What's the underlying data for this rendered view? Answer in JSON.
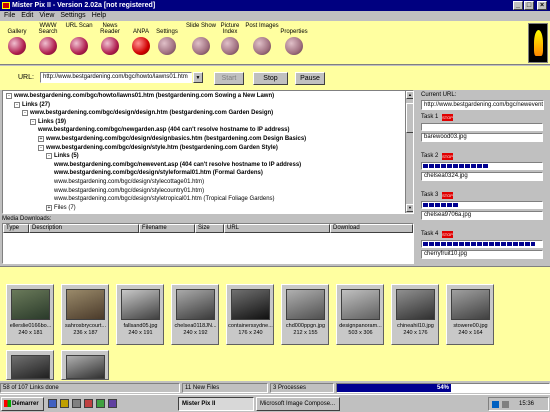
{
  "window": {
    "title": "Mister Pix II - Version 2.02a [not registered]"
  },
  "menu": [
    "File",
    "Edit",
    "View",
    "Settings",
    "Help"
  ],
  "toolbar": {
    "tools": [
      {
        "label": "Gallery",
        "icon": "gallery-icon"
      },
      {
        "label": "WWW Search",
        "icon": "search-icon"
      },
      {
        "label": "URL Scan",
        "icon": "url-scan-icon"
      },
      {
        "label": "News Reader",
        "icon": "news-reader-icon"
      },
      {
        "label": "ANPA",
        "icon": "anpa-icon"
      },
      {
        "label": "Settings",
        "icon": "settings-icon"
      },
      {
        "label": "Slide Show",
        "icon": "slide-show-icon"
      },
      {
        "label": "Picture Index",
        "icon": "picture-index-icon"
      },
      {
        "label": "Post Images",
        "icon": "post-images-icon"
      },
      {
        "label": "Properties",
        "icon": "properties-icon"
      }
    ]
  },
  "urlbar": {
    "label": "URL:",
    "value": "http://www.bestgardening.com/bgc/howto/lawns01.htm",
    "start": "Start",
    "stop": "Stop",
    "pause": "Pause"
  },
  "tree": [
    {
      "text": "www.bestgardening.com/bgc/howto/lawns01.htm (bestgardening.com Sowing a New Lawn)",
      "pm": "-",
      "indent": 0,
      "bold": true
    },
    {
      "text": "Links (27)",
      "pm": "-",
      "indent": 1,
      "bold": true
    },
    {
      "text": "www.bestgardening.com/bgc/design/design.htm (bestgardening.com Garden Design)",
      "pm": "-",
      "indent": 2,
      "bold": true
    },
    {
      "text": "Links (19)",
      "pm": "-",
      "indent": 3,
      "bold": true
    },
    {
      "text": "www.bestgardening.com/bgc/newgarden.asp (404 can't resolve hostname to IP address)",
      "pm": "",
      "indent": 4,
      "bold": true
    },
    {
      "text": "www.bestgardening.com/bgc/design/designbasics.htm (bestgardening.com Design Basics)",
      "pm": "+",
      "indent": 4,
      "bold": true
    },
    {
      "text": "www.bestgardening.com/bgc/design/style.htm (bestgardening.com Garden Style)",
      "pm": "-",
      "indent": 4,
      "bold": true
    },
    {
      "text": "Links (5)",
      "pm": "-",
      "indent": 5,
      "bold": true
    },
    {
      "text": "www.bestgardening.com/bgc/newevent.asp (404 can't resolve hostname to IP address)",
      "pm": "",
      "indent": 6,
      "bold": true
    },
    {
      "text": "www.bestgardening.com/bgc/design/styleformal01.htm (Formal Gardens)",
      "pm": "",
      "indent": 6,
      "bold": true
    },
    {
      "text": "www.bestgardening.com/bgc/design/stylecottage01.htm)",
      "pm": "",
      "indent": 6,
      "bold": false
    },
    {
      "text": "www.bestgardening.com/bgc/design/stylecountry01.htm)",
      "pm": "",
      "indent": 6,
      "bold": false
    },
    {
      "text": "www.bestgardening.com/bgc/design/styletropical01.htm (Tropical Foliage Gardens)",
      "pm": "",
      "indent": 6,
      "bold": false
    },
    {
      "text": "Files (7)",
      "pm": "+",
      "indent": 5,
      "bold": false
    }
  ],
  "media": {
    "label": "Media Downloads:",
    "columns": [
      "Type",
      "Description",
      "Filename",
      "Size",
      "URL",
      "Download"
    ]
  },
  "current": {
    "label": "Current URL:",
    "url": "http://www.bestgardening.com/bgc/newevent.asp"
  },
  "tasks": [
    {
      "label": "Task 1",
      "stop": "STOP",
      "file": "barewood03.jpg",
      "progress": 0
    },
    {
      "label": "Task 2",
      "stop": "STOP",
      "file": "chelsea0324.jpg",
      "progress": 0.55
    },
    {
      "label": "Task 3",
      "stop": "STOP",
      "file": "chelsea9706a.jpg",
      "progress": 0.3
    },
    {
      "label": "Task 4",
      "stop": "STOP",
      "file": "cherryfruit10.jpg",
      "progress": 0.95
    }
  ],
  "gallery": [
    {
      "name": "ellerslie0166bo...",
      "dims": "240 x 181",
      "colors": [
        "#6a7a5a",
        "#2a3a2a"
      ]
    },
    {
      "name": "sahrosbrycourt...",
      "dims": "236 x 187",
      "colors": [
        "#9a8a6a",
        "#4a3a2a"
      ]
    },
    {
      "name": "fallsand05.jpg",
      "dims": "240 x 191",
      "colors": [
        "#c8c8c8",
        "#404040"
      ]
    },
    {
      "name": "chelsea0118JN...",
      "dims": "240 x 192",
      "colors": [
        "#aaaaaa",
        "#3a3a3a"
      ]
    },
    {
      "name": "containerssydne...",
      "dims": "176 x 240",
      "colors": [
        "#707070",
        "#101010"
      ]
    },
    {
      "name": "chd000ppgn.jpg",
      "dims": "212 x 155",
      "colors": [
        "#b0b0b0",
        "#505050"
      ]
    },
    {
      "name": "designpanoram...",
      "dims": "503 x 306",
      "colors": [
        "#c0c0c0",
        "#606060"
      ]
    },
    {
      "name": "chineahil10.jpg",
      "dims": "240 x 176",
      "colors": [
        "#909090",
        "#303030"
      ]
    },
    {
      "name": "stowere00.jpg",
      "dims": "240 x 164",
      "colors": [
        "#a0a0a0",
        "#404040"
      ]
    },
    {
      "name": "",
      "dims": "",
      "colors": [
        "#707070",
        "#202020"
      ]
    },
    {
      "name": "",
      "dims": "",
      "colors": [
        "#b0b0b0",
        "#303030"
      ]
    }
  ],
  "status": {
    "links": "58 of 107 Links done",
    "files": "11 New Files",
    "processes": "3 Processes",
    "percent": "54%",
    "percent_value": 0.54
  },
  "taskbar": {
    "start": "Démarrer",
    "apps": [
      "Mister Pix II",
      "Microsoft Image Compose..."
    ],
    "clock": "15:36"
  }
}
